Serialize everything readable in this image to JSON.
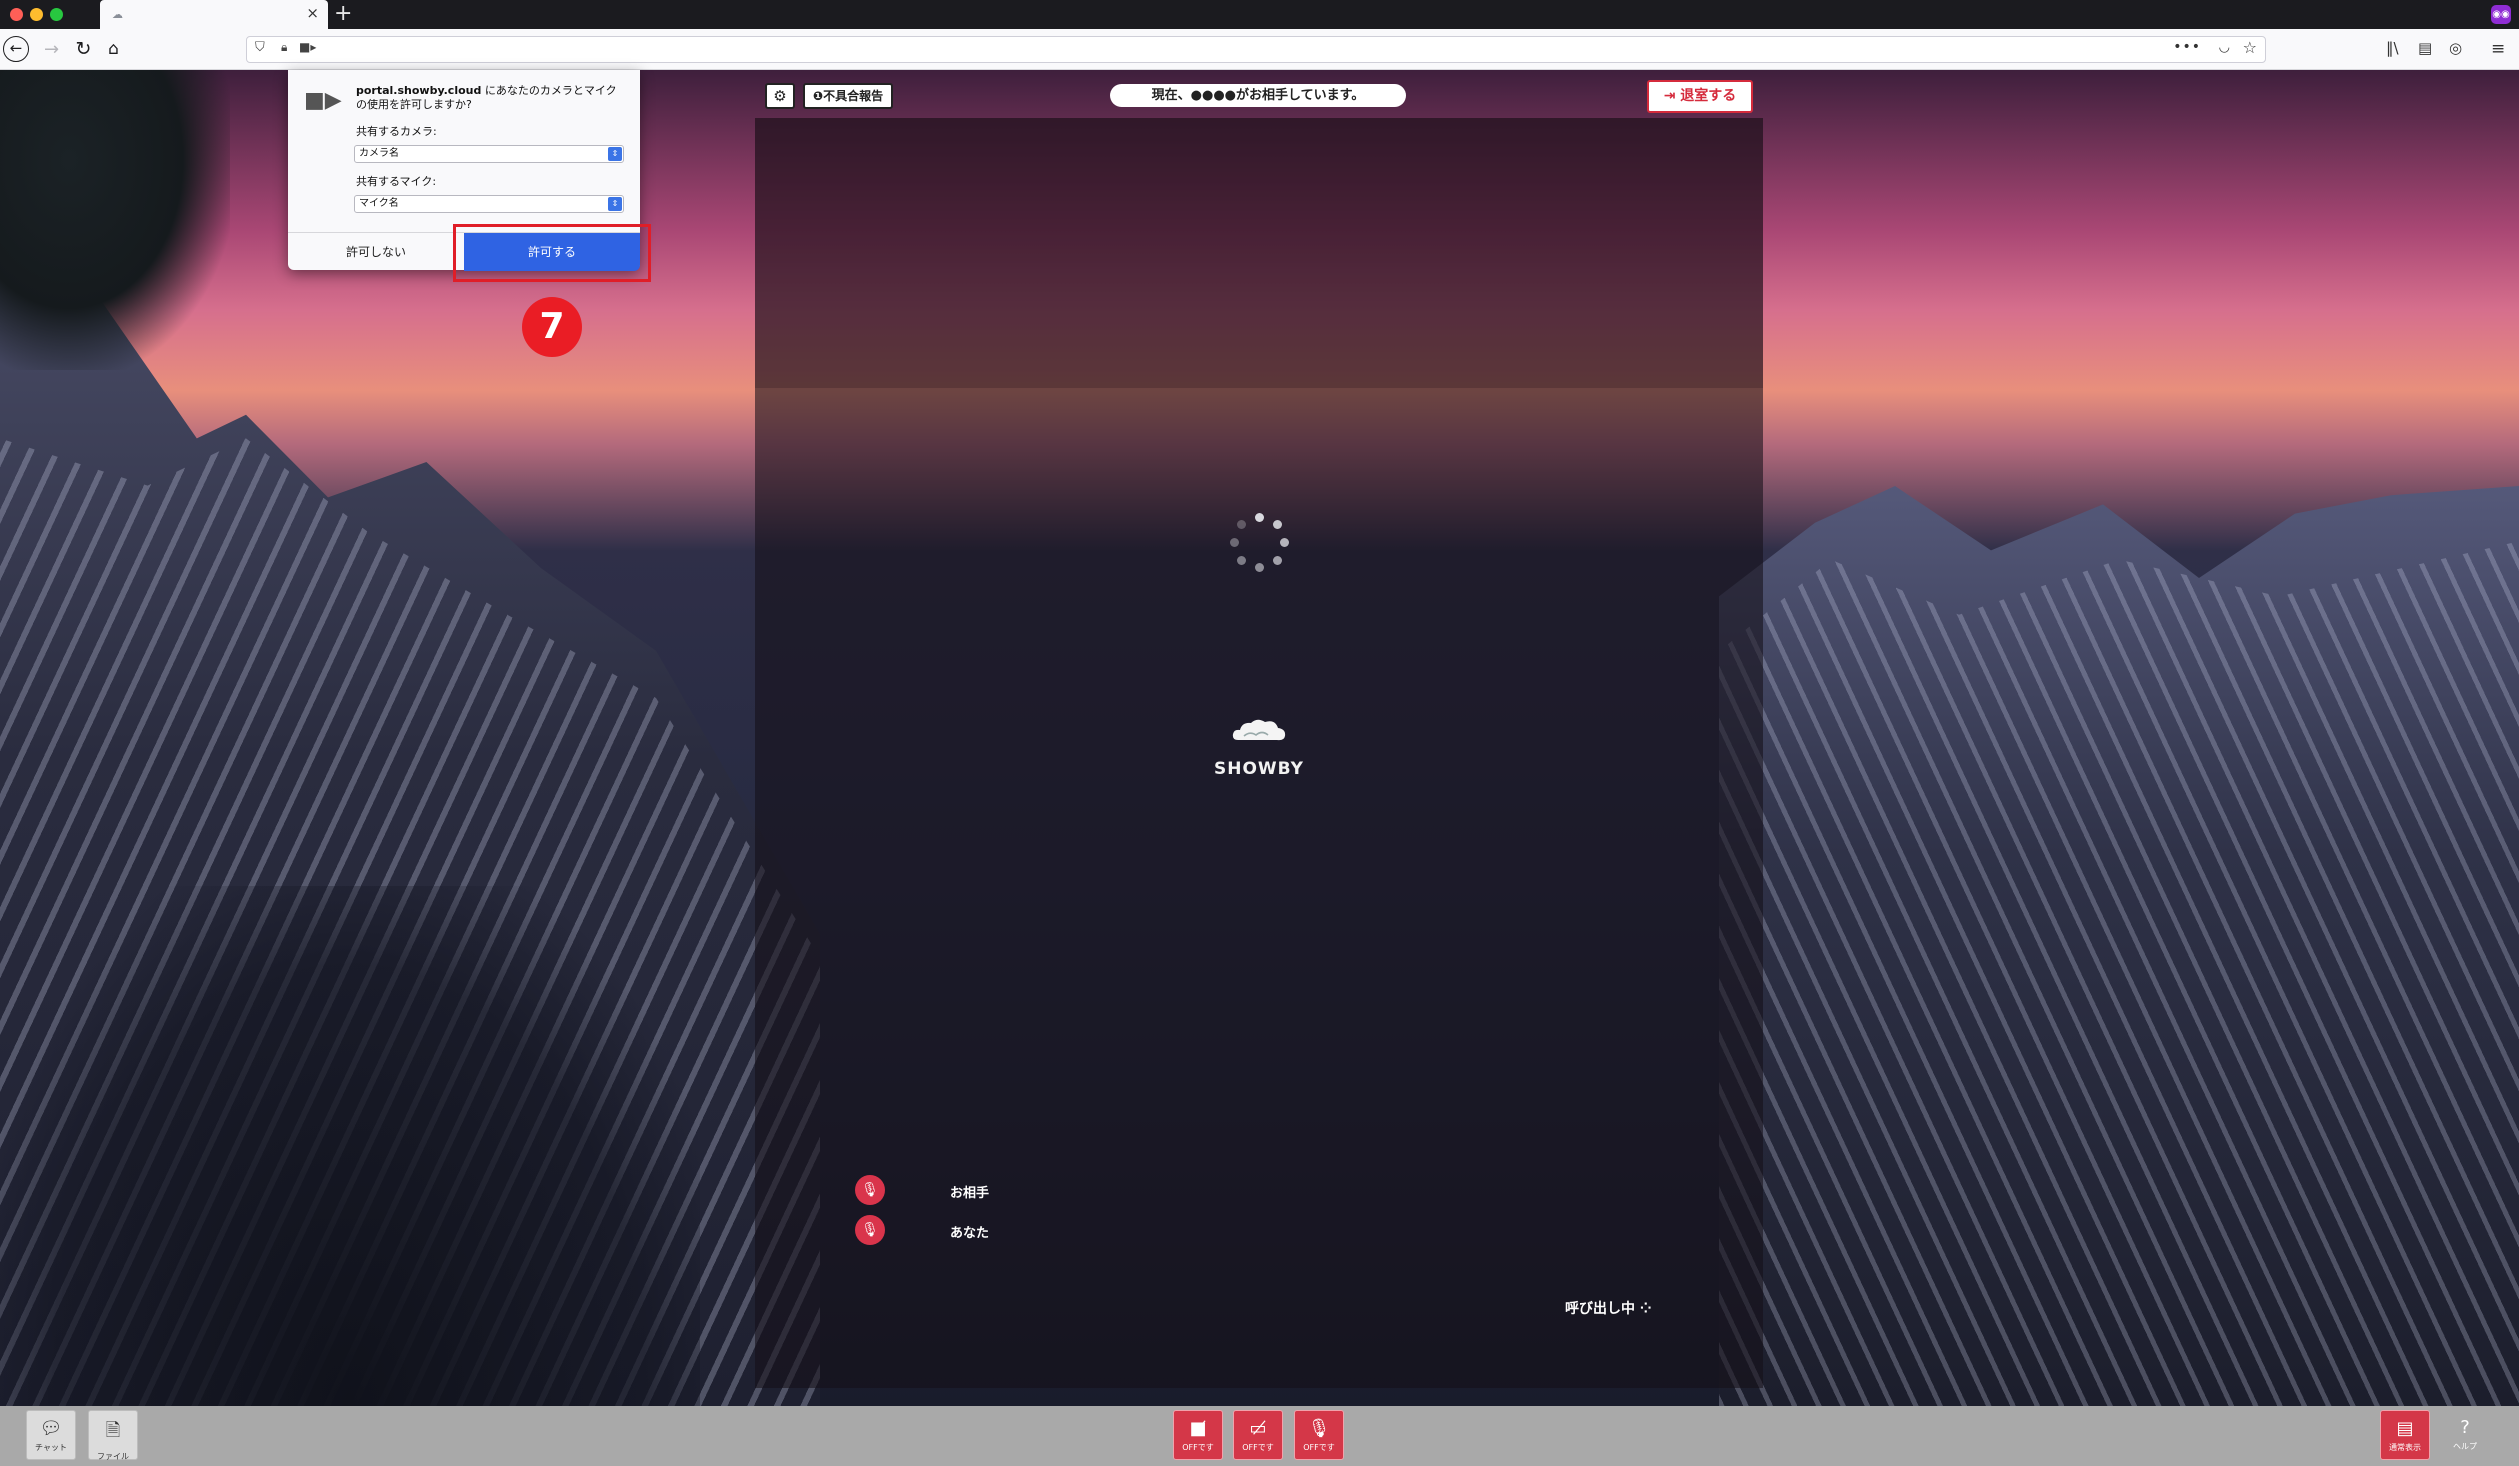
{
  "browser": {
    "tab_close": "×",
    "new_tab": "+",
    "icons": {
      "back": "arrow-left-icon",
      "forward": "arrow-right-icon",
      "reload": "reload-icon",
      "home": "home-icon",
      "shield": "shield-icon",
      "lock": "lock-icon",
      "camera": "camera-icon",
      "more": "more-dots-icon",
      "pocket": "pocket-icon",
      "bookmark": "star-icon",
      "library": "library-icon",
      "sidebar": "sidebar-icon",
      "account": "account-icon",
      "menu": "hamburger-icon",
      "extension": "mask-icon"
    },
    "colors": {
      "allow_button": "#2f63e3",
      "extension": "#8f2dd4"
    }
  },
  "permission_popup": {
    "domain": "portal.showby.cloud",
    "message": " にあなたのカメラとマイクの使用を許可しますか?",
    "camera_label": "共有するカメラ:",
    "camera_value": "カメラ名",
    "mic_label": "共有するマイク:",
    "mic_value": "マイク名",
    "deny_label": "許可しない",
    "allow_label": "許可する",
    "step_number": "7"
  },
  "header": {
    "report_label": "不具合報告",
    "status": "現在、●●●●がお相手しています。",
    "leave_label": "退室する"
  },
  "video": {
    "logo": "SHOWBY",
    "calling": "呼び出し中",
    "partner": "お相手",
    "self": "あなた"
  },
  "toolbar": {
    "chat": "チャット",
    "file": "ファイル",
    "camera_off": "OFFです",
    "screen_off": "OFFです",
    "mic_off": "OFFです",
    "normal_view": "通常表示",
    "help": "ヘルプ"
  },
  "colors": {
    "danger": "#d52b3c",
    "step_badge": "#ea1d25"
  }
}
